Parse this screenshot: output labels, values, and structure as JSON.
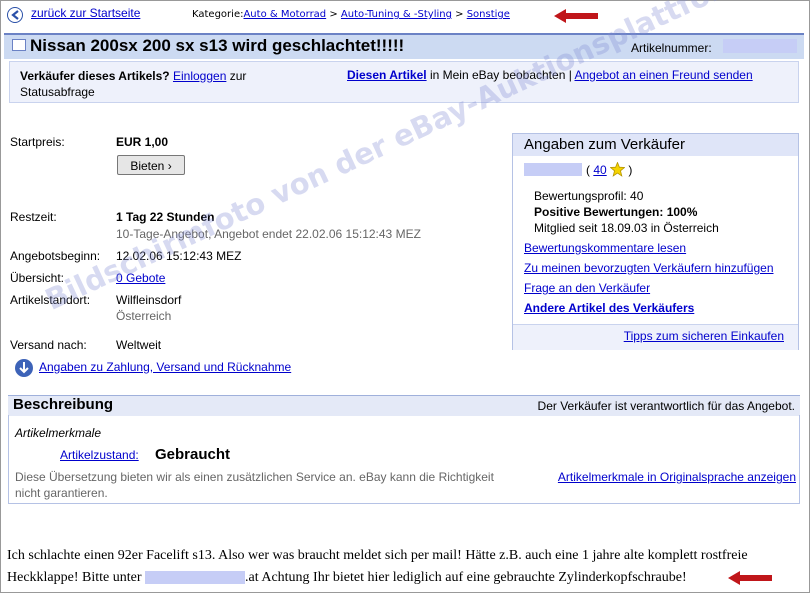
{
  "nav": {
    "back_label": "zurück zur Startseite",
    "category_prefix": "Kategorie:",
    "crumbs": [
      "Auto & Motorrad",
      "Auto-Tuning & -Styling",
      "Sonstige"
    ],
    "sep": ">"
  },
  "title": {
    "text": "Nissan 200sx 200 sx s13 wird geschlachtet!!!!!",
    "article_number_label": "Artikelnummer:"
  },
  "login_bar": {
    "question": "Verkäufer dieses Artikels?",
    "login_link": "Einloggen",
    "login_tail": "zur Statusabfrage",
    "watch_link": "Diesen Artikel",
    "watch_tail": "in Mein eBay beobachten |",
    "friend_link": "Angebot an einen Freund senden"
  },
  "details": {
    "start_label": "Startpreis:",
    "start_value": "EUR 1,00",
    "bid_button": "Bieten",
    "remaining_label": "Restzeit:",
    "remaining_value": "1 Tag 22 Stunden",
    "remaining_sub": "10-Tage-Angebot, Angebot endet 22.02.06 15:12:43 MEZ",
    "begin_label": "Angebotsbeginn:",
    "begin_value": "12.02.06 15:12:43 MEZ",
    "overview_label": "Übersicht:",
    "overview_link": "0 Gebote",
    "location_label": "Artikelstandort:",
    "location_value": "Wilfleinsdorf",
    "location_country": "Österreich",
    "shipping_label": "Versand nach:",
    "shipping_value": "Weltweit",
    "payment_link": "Angaben zu Zahlung, Versand und Rücknahme"
  },
  "seller": {
    "heading": "Angaben zum Verkäufer",
    "rating_open": "(",
    "rating": "40",
    "rating_close": ")",
    "profile": "Bewertungsprofil: 40",
    "positive": "Positive Bewertungen: 100%",
    "member": "Mitglied seit 18.09.03 in Österreich",
    "links": [
      "Bewertungskommentare lesen",
      "Zu meinen bevorzugten Verkäufern hinzufügen",
      "Frage an den Verkäufer"
    ],
    "other_items": "Andere Artikel des Verkäufers",
    "tips": "Tipps zum sicheren Einkaufen"
  },
  "description": {
    "heading": "Beschreibung",
    "responsibility": "Der Verkäufer ist verantwortlich für das Angebot.",
    "features_title": "Artikelmerkmale",
    "condition_label": "Artikelzustand:",
    "condition_value": "Gebraucht",
    "translation_note": "Diese Übersetzung bieten wir als einen zusätzlichen Service an. eBay kann die Richtigkeit nicht garantieren.",
    "original_link": "Artikelmerkmale in Originalsprache anzeigen"
  },
  "body_text": {
    "line1": "Ich schlachte einen 92er Facelift s13. Also wer was braucht meldet sich per mail! Hätte z.B. auch eine 1 jahre alte komplett rostfreie",
    "line2_a": "Heckklappe! Bitte unter",
    "line2_b": ".at Achtung Ihr bietet hier lediglich auf eine gebrauchte Zylinderkopfschraube!"
  },
  "watermark": "Bildschirmfoto von der eBay-Auktionsplattform",
  "colors": {
    "link": "#0000cc",
    "title_bar": "#ccdaf2",
    "highlight_box": "#c6cdf6",
    "red_arrow": "#c0161a"
  }
}
